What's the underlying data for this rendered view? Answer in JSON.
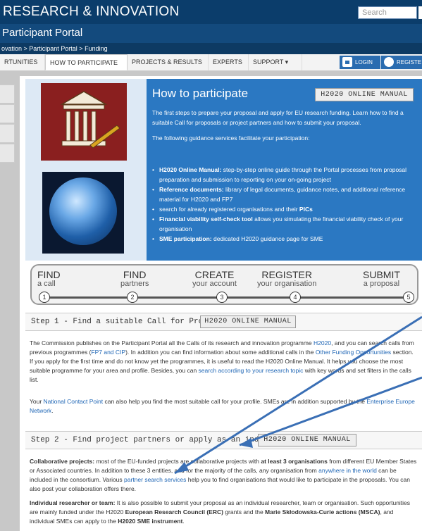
{
  "header": {
    "site_title": "RESEARCH & INNOVATION",
    "search_placeholder": "Search",
    "portal_title": "Participant Portal"
  },
  "breadcrumb": {
    "text": "ovation > Participant Portal > Funding"
  },
  "nav": {
    "items": [
      "RTUNITIES",
      "HOW TO PARTICIPATE",
      "PROJECTS & RESULTS",
      "EXPERTS",
      "SUPPORT ▾"
    ],
    "login": "LOGIN",
    "register": "REGISTE"
  },
  "hero": {
    "title": "How to participate",
    "manual_button": "H2020 ONLINE MANUAL",
    "intro": "The first steps to prepare your proposal and apply for EU research funding. Learn how to find a suitable Call for proposals or project partners and how to submit your proposal.",
    "guidance_intro": "The following guidance services facilitate your participation:",
    "list": [
      {
        "bold": "H2020 Online Manual:",
        "text": " step-by-step online guide through the Portal processes from proposal preparation and submission to reporting on your on-going project"
      },
      {
        "bold": "Reference documents:",
        "text": " library of legal documents, guidance notes, and additional reference material for H2020 and FP7"
      },
      {
        "bold": "",
        "text": "search for already registered organisations and their ",
        "bold_end": "PICs"
      },
      {
        "bold": "Financial viability self-check tool",
        "text": " allows you simulating the financial viability check of your organisation"
      },
      {
        "bold": "SME participation:",
        "text": " dedicated H2020 guidance page for SME"
      }
    ]
  },
  "steps": [
    {
      "big": "FIND",
      "small": "a call",
      "num": "1"
    },
    {
      "big": "FIND",
      "small": "partners",
      "num": "2"
    },
    {
      "big": "CREATE",
      "small": "your account",
      "num": "3"
    },
    {
      "big": "REGISTER",
      "small": "your organisation",
      "num": "4"
    },
    {
      "big": "SUBMIT",
      "small": "a proposal",
      "num": "5"
    }
  ],
  "step1": {
    "title": "Step 1 - Find a suitable Call for Proposals",
    "manual_button": "H2020 ONLINE MANUAL",
    "p1_a": "The Commission publishes on the Participant Portal all the Calls of its research and innovation programme ",
    "p1_link1": "H2020",
    "p1_b": ", and you can search calls from previous programmes (",
    "p1_link2": "FP7 and CIP",
    "p1_c": "). In addition you can find information about some additional calls in the ",
    "p1_link3": "Other Funding Opportunities",
    "p1_d": " section. If you apply for the first time and do not know yet the programmes, it is useful to read the H2020 Online Manual. It helps you choose the most suitable programme for your area and profile. Besides, you can ",
    "p1_link4": "search according to your research topic",
    "p1_e": " with key words and set filters in the calls list.",
    "p2_a": "Your ",
    "p2_link1": "National Contact Point",
    "p2_b": " can also help you find the most suitable call for your profile. SMEs are in addition supported by the ",
    "p2_link2": "Enterprise Europe Network",
    "p2_c": "."
  },
  "step2": {
    "title": "Step 2 - Find project partners or apply as an individual",
    "manual_button": "H2020 ONLINE MANUAL",
    "p1_bold": "Collaborative projects:",
    "p1_a": " most of the EU-funded projects are collaborative projects with ",
    "p1_bold2": "at least 3 organisations",
    "p1_b": " from different EU Member States or Associated countries. In addition to these 3 entities, and for the majority of the calls, any organisation from ",
    "p1_link1": "anywhere in the world",
    "p1_c": " can be included in the consortium. Various ",
    "p1_link2": "partner search services",
    "p1_d": " help you to find organisations that would like to participate in the proposals. You can also post your collaboration offers there.",
    "p2_bold": "Individual researcher or team:",
    "p2_a": " It is also possible to submit your proposal as an individual researcher, team or organisation. Such opportunities are mainly funded under the H2020 ",
    "p2_bold2": "European Research Council (ERC)",
    "p2_b": " grants and the ",
    "p2_bold3": "Marie Skłodowska-Curie actions (MSCA)",
    "p2_c": ", and individual SMEs can apply to the ",
    "p2_bold4": "H2020 SME instrument",
    "p2_d": "."
  },
  "colors": {
    "header": "#0b3d6b",
    "hero": "#2b78c2",
    "link": "#1f66b5",
    "annotation_arrow": "#3a6fb5"
  }
}
